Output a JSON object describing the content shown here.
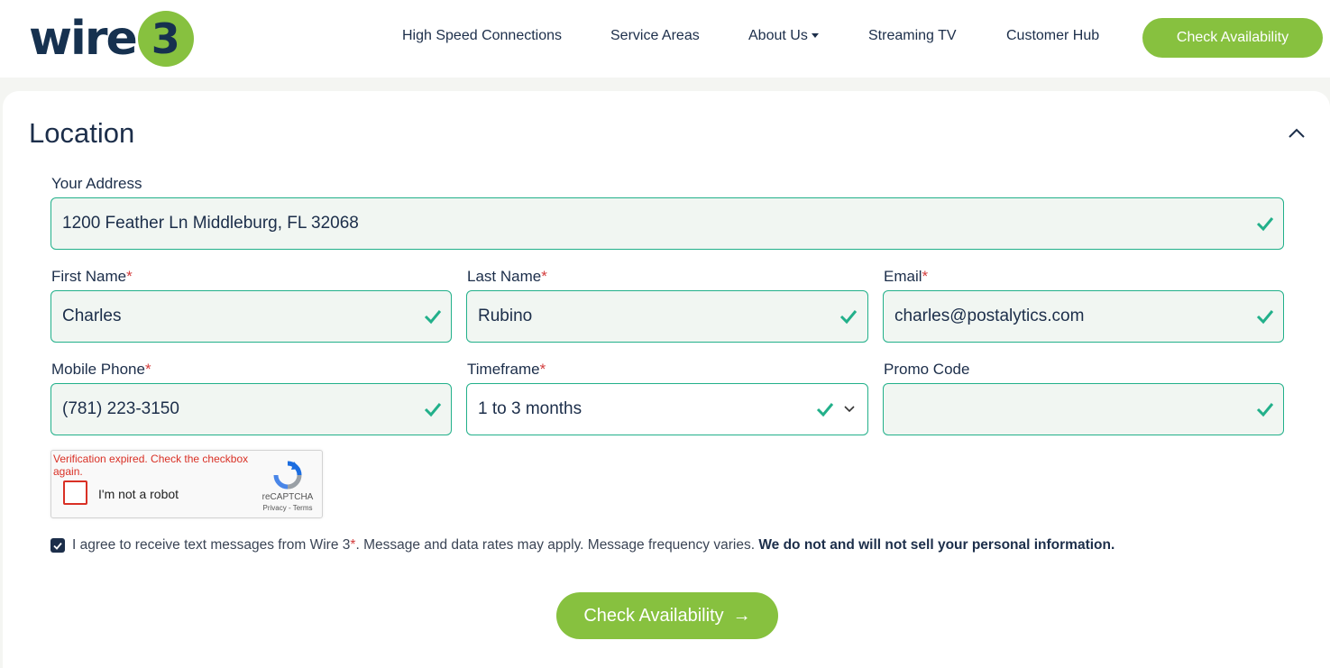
{
  "brand": {
    "logo_word": "wire",
    "logo_number": "3"
  },
  "nav": {
    "items": [
      "High Speed Connections",
      "Service Areas",
      "About Us",
      "Streaming TV",
      "Customer Hub"
    ],
    "cta": "Check Availability"
  },
  "section": {
    "title": "Location"
  },
  "form": {
    "address": {
      "label": "Your Address",
      "value": "1200 Feather Ln Middleburg, FL 32068"
    },
    "first_name": {
      "label": "First Name",
      "required": "*",
      "value": "Charles"
    },
    "last_name": {
      "label": "Last Name",
      "required": "*",
      "value": "Rubino"
    },
    "email": {
      "label": "Email",
      "required": "*",
      "value": "charles@postalytics.com"
    },
    "phone": {
      "label": "Mobile Phone",
      "required": "*",
      "value": "(781) 223-3150"
    },
    "timeframe": {
      "label": "Timeframe",
      "required": "*",
      "value": "1 to 3 months"
    },
    "promo": {
      "label": "Promo Code",
      "value": ""
    }
  },
  "captcha": {
    "error": "Verification expired. Check the checkbox again.",
    "label": "I'm not a robot",
    "brand": "reCAPTCHA",
    "links": "Privacy - Terms"
  },
  "consent": {
    "checked": true,
    "text_before": "I agree to receive text messages from Wire 3",
    "required": "*",
    "text_after": ". Message and data rates may apply. Message frequency varies. ",
    "bold": "We do not and will not sell your personal information."
  },
  "submit": {
    "label": "Check Availability",
    "arrow": "→"
  },
  "colors": {
    "navy": "#1c2e4a",
    "green": "#87c13f",
    "valid": "#22b08a",
    "error": "#d93025"
  }
}
